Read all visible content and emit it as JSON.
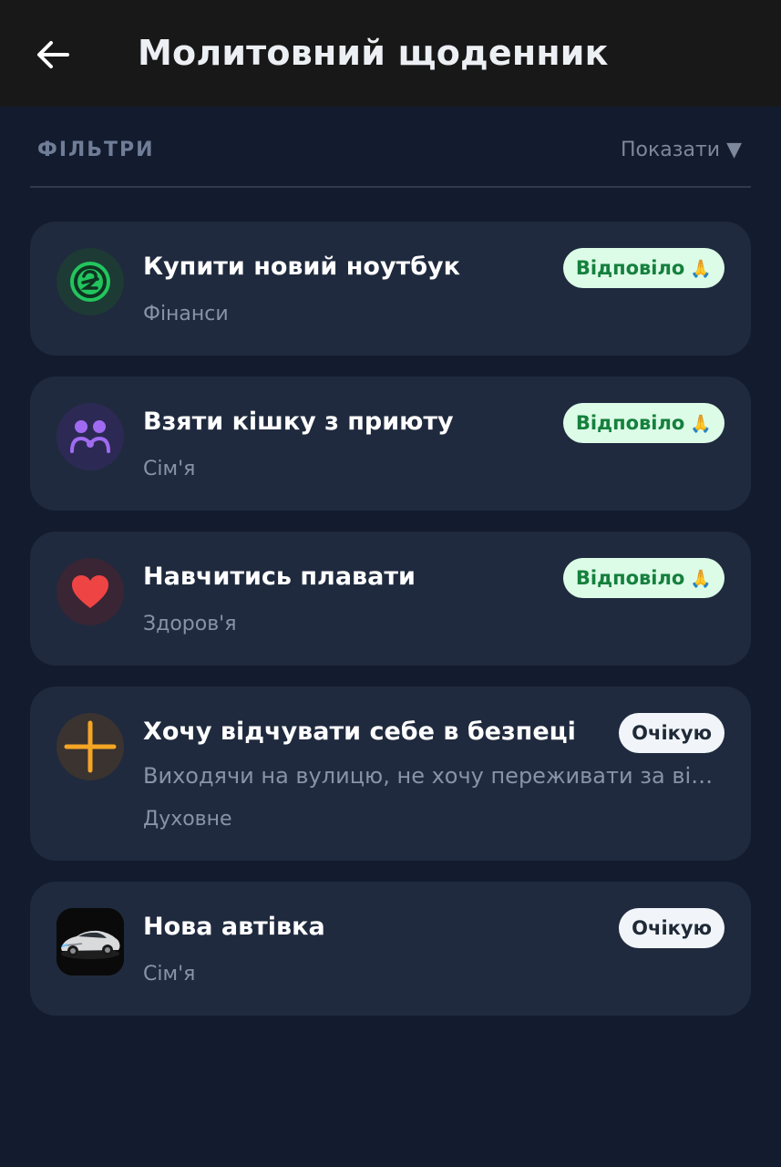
{
  "header": {
    "title": "Молитовний щоденник",
    "back_icon": "arrow-left-icon"
  },
  "filters": {
    "label": "ФІЛЬТРИ",
    "toggle_label": "Показати ▼"
  },
  "prayers": [
    {
      "title": "Купити новий ноутбук",
      "category": "Фінанси",
      "status": "Відповіло",
      "status_emoji": "🙏",
      "icon": "currency-icon",
      "icon_color": "#22c55e"
    },
    {
      "title": "Взяти кішку з приюту",
      "category": "Сім'я",
      "status": "Відповіло",
      "status_emoji": "🙏",
      "icon": "family-icon",
      "icon_color": "#a06bf0"
    },
    {
      "title": "Навчитись плавати",
      "category": "Здоров'я",
      "status": "Відповіло",
      "status_emoji": "🙏",
      "icon": "heart-icon",
      "icon_color": "#ef4444"
    },
    {
      "title": "Хочу відчувати себе в безпеці",
      "description": "Виходячи на вулицю, не хочу переживати за війну",
      "category": "Духовне",
      "status": "Очікую",
      "icon": "cross-icon",
      "icon_color": "#f5a524"
    },
    {
      "title": "Нова автівка",
      "category": "Сім'я",
      "status": "Очікую",
      "icon": "car-photo"
    }
  ]
}
